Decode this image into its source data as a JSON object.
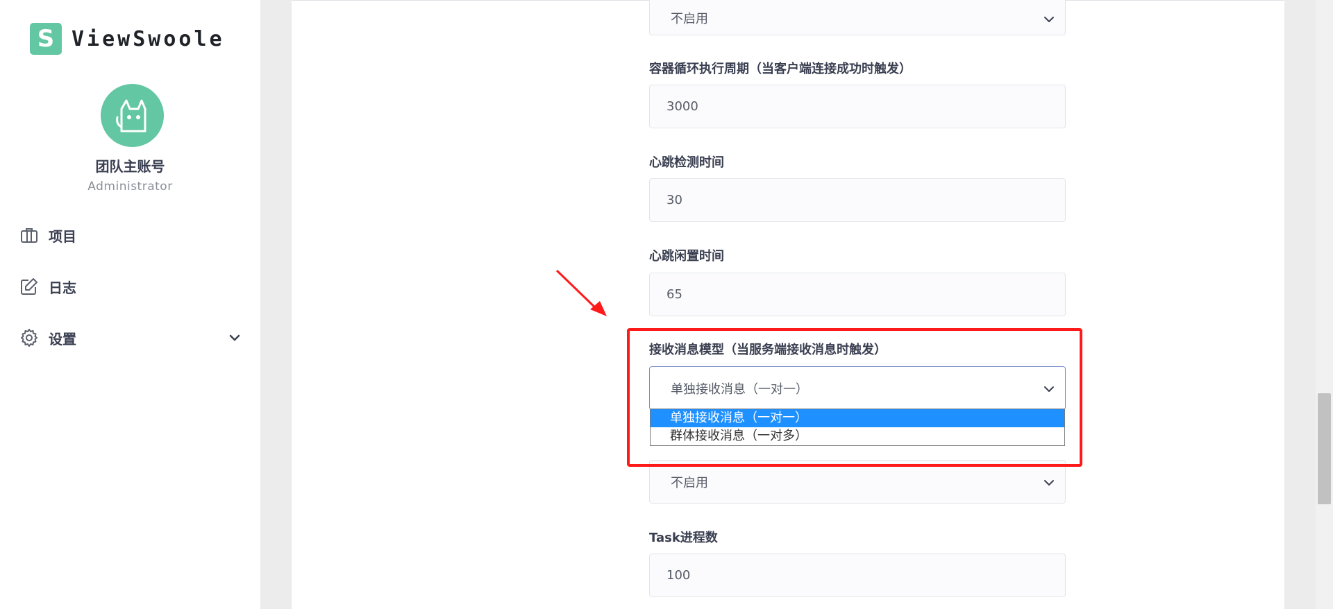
{
  "brand": {
    "logo_letter": "S",
    "name": "ViewSwoole"
  },
  "user": {
    "name": "团队主账号",
    "role": "Administrator"
  },
  "nav": {
    "items": [
      {
        "label": "项目",
        "icon": "briefcase-icon"
      },
      {
        "label": "日志",
        "icon": "edit-icon"
      },
      {
        "label": "设置",
        "icon": "gear-icon"
      }
    ]
  },
  "form": {
    "top_select_value": "不启用",
    "container_cycle": {
      "label": "容器循环执行周期（当客户端连接成功时触发）",
      "value": "3000"
    },
    "heartbeat_check": {
      "label": "心跳检测时间",
      "value": "30"
    },
    "heartbeat_idle": {
      "label": "心跳闲置时间",
      "value": "65"
    },
    "receive_model": {
      "label": "接收消息模型（当服务端接收消息时触发）",
      "value": "单独接收消息（一对一）",
      "options": [
        "单独接收消息（一对一）",
        "群体接收消息（一对多）"
      ]
    },
    "hidden_select_value": "不启用",
    "task_workers": {
      "label": "Task进程数",
      "value": "100"
    }
  },
  "colors": {
    "accent": "#63c7a3",
    "highlight": "#ff1a1a",
    "selected_option": "#1e90ff"
  }
}
